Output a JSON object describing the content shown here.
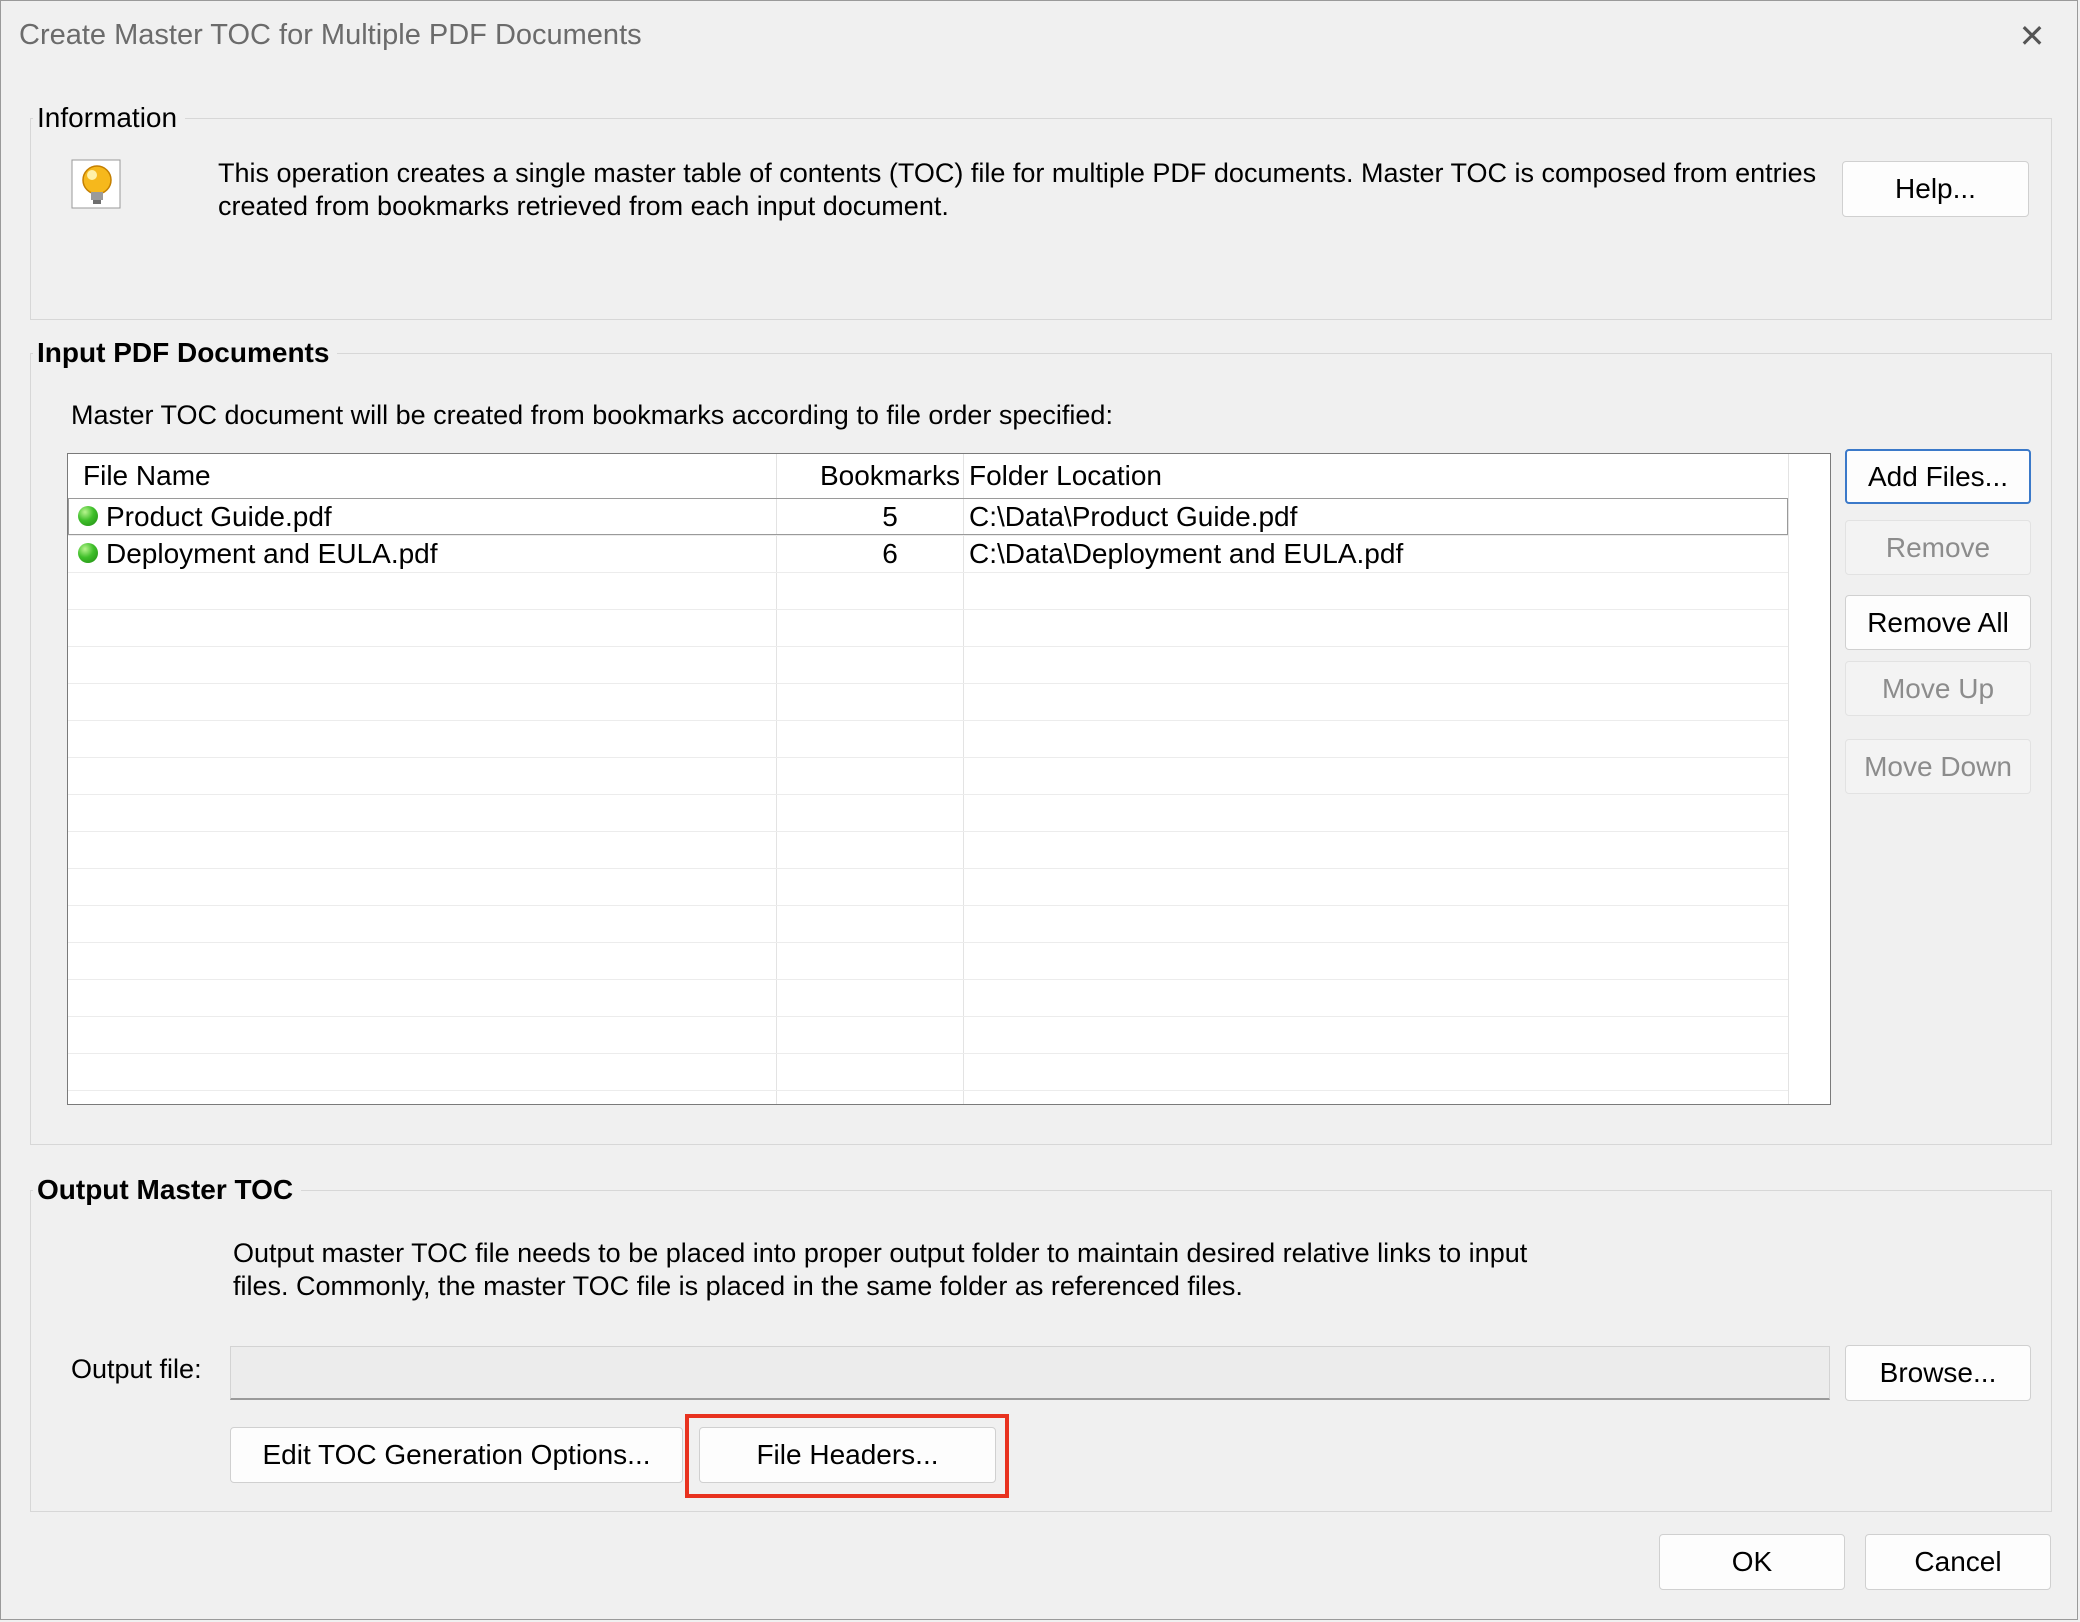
{
  "window": {
    "title": "Create Master TOC for Multiple PDF Documents",
    "close_symbol": "✕"
  },
  "information": {
    "group_label": "Information",
    "icon": "lightbulb-icon",
    "text_line1": "This operation creates a single master table of contents (TOC) file for multiple PDF documents. Master TOC is composed from entries",
    "text_line2": "created from bookmarks retrieved from each input document.",
    "help_button": "Help..."
  },
  "input": {
    "group_label": "Input PDF Documents",
    "description": "Master TOC document will be created from bookmarks according to file order specified:",
    "columns": [
      "File Name",
      "Bookmarks",
      "Folder Location"
    ],
    "rows": [
      {
        "name": "Product Guide.pdf",
        "bookmarks": "5",
        "location": "C:\\Data\\Product Guide.pdf",
        "status": "ok"
      },
      {
        "name": "Deployment and EULA.pdf",
        "bookmarks": "6",
        "location": "C:\\Data\\Deployment and EULA.pdf",
        "status": "ok"
      }
    ],
    "buttons": {
      "add_files": "Add Files...",
      "remove": "Remove",
      "remove_all": "Remove All",
      "move_up": "Move Up",
      "move_down": "Move Down"
    }
  },
  "output": {
    "group_label": "Output Master TOC",
    "text_line1": "Output master TOC file needs to be placed into proper output folder to maintain desired relative links to input",
    "text_line2": "files. Commonly, the master TOC file is placed in the same folder as referenced files.",
    "output_file_label": "Output file:",
    "output_file_value": "",
    "browse_button": "Browse...",
    "edit_options_button": "Edit TOC Generation Options...",
    "file_headers_button": "File Headers..."
  },
  "footer": {
    "ok": "OK",
    "cancel": "Cancel"
  },
  "colors": {
    "highlight": "#e8321f",
    "status_ok": "#3fbf2a"
  }
}
